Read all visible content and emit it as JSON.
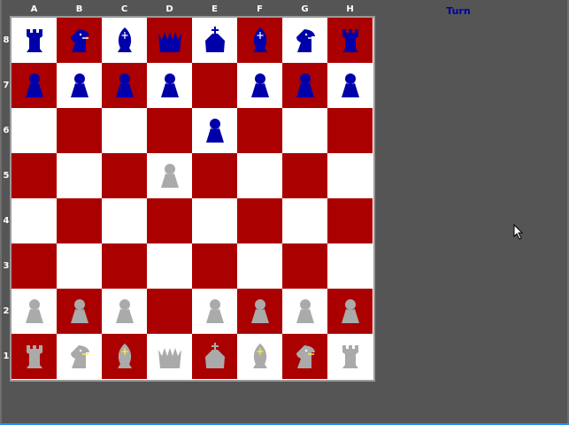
{
  "turn_label": "Turn",
  "files": [
    "A",
    "B",
    "C",
    "D",
    "E",
    "F",
    "G",
    "H"
  ],
  "ranks": [
    "8",
    "7",
    "6",
    "5",
    "4",
    "3",
    "2",
    "1"
  ],
  "colors": {
    "background": "#555555",
    "light_square": "#ffffff",
    "dark_square": "#aa0000",
    "black_pieces": "#0000aa",
    "white_pieces": "#aaaaaa",
    "turn_text": "#0000aa"
  },
  "position": [
    [
      "bR",
      "bN",
      "bB",
      "bQ",
      "bK",
      "bB",
      "bN",
      "bR"
    ],
    [
      "bP",
      "bP",
      "bP",
      "bP",
      "",
      "bP",
      "bP",
      "bP"
    ],
    [
      "",
      "",
      "",
      "",
      "bP",
      "",
      "",
      ""
    ],
    [
      "",
      "",
      "",
      "wP",
      "",
      "",
      "",
      ""
    ],
    [
      "",
      "",
      "",
      "",
      "",
      "",
      "",
      ""
    ],
    [
      "",
      "",
      "",
      "",
      "",
      "",
      "",
      ""
    ],
    [
      "wP",
      "wP",
      "wP",
      "",
      "wP",
      "wP",
      "wP",
      "wP"
    ],
    [
      "wR",
      "wN",
      "wB",
      "wQ",
      "wK",
      "wB",
      "wN",
      "wR"
    ]
  ],
  "piece_icons": {
    "P": "pawn-icon",
    "R": "rook-icon",
    "N": "knight-icon",
    "B": "bishop-icon",
    "Q": "queen-icon",
    "K": "king-icon"
  }
}
